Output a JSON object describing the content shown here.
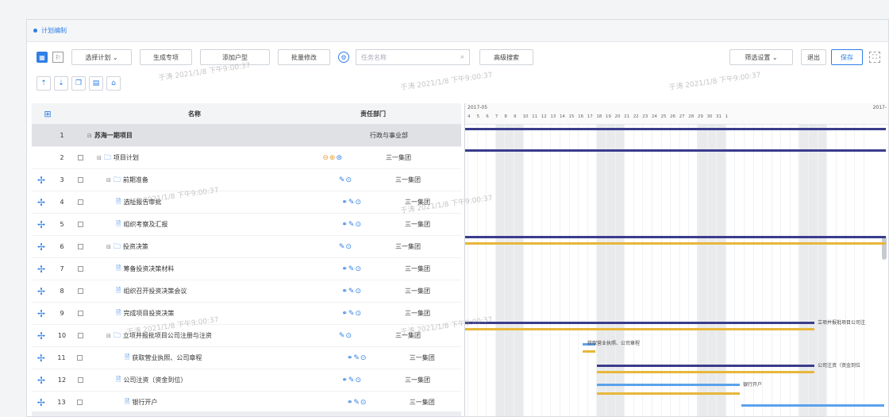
{
  "window": {
    "title": "计划编制"
  },
  "toolbar": {
    "buttons": [
      "选择计划 ⌄",
      "生成专项",
      "添加户型",
      "批量修改"
    ],
    "search_placeholder": "任务名称",
    "search_button": "高级搜索",
    "right_dropdown": "筛选设置 ⌄",
    "right_buttons": [
      "退出",
      "保存"
    ]
  },
  "grid": {
    "headers": {
      "name": "名称",
      "dept": "责任部门"
    },
    "rows": [
      {
        "num": "1",
        "name": "苏海一期项目",
        "dept": "行政与事业部",
        "level": 0
      },
      {
        "num": "2",
        "name": "项目计划",
        "dept": "三一集团",
        "level": 1
      },
      {
        "num": "3",
        "name": "前期准备",
        "dept": "三一集团",
        "level": 2
      },
      {
        "num": "4",
        "name": "选址报告审批",
        "dept": "三一集团",
        "level": 3
      },
      {
        "num": "5",
        "name": "组织考察及汇报",
        "dept": "三一集团",
        "level": 3
      },
      {
        "num": "6",
        "name": "投资决策",
        "dept": "三一集团",
        "level": 2
      },
      {
        "num": "7",
        "name": "筹备投资决策材料",
        "dept": "三一集团",
        "level": 3
      },
      {
        "num": "8",
        "name": "组织召开投资决策会议",
        "dept": "三一集团",
        "level": 3
      },
      {
        "num": "9",
        "name": "完成项目投资决策",
        "dept": "三一集团",
        "level": 3
      },
      {
        "num": "10",
        "name": "立项并报批项目公司注册与注资",
        "dept": "三一集团",
        "level": 2
      },
      {
        "num": "11",
        "name": "获取营业执照、公司章程",
        "dept": "三一集团",
        "level": 4
      },
      {
        "num": "12",
        "name": "公司注资（资金到位）",
        "dept": "三一集团",
        "level": 3
      },
      {
        "num": "13",
        "name": "银行开户",
        "dept": "三一集团",
        "level": 4
      }
    ]
  },
  "gantt": {
    "month_left": "2017-05",
    "month_right": "2017-",
    "days": [
      "4",
      "5",
      "6",
      "7",
      "8",
      "9",
      "10",
      "11",
      "12",
      "13",
      "14",
      "15",
      "16",
      "17",
      "18",
      "19",
      "20",
      "21",
      "22",
      "23",
      "24",
      "25",
      "26",
      "27",
      "28",
      "29",
      "30",
      "31",
      "1"
    ],
    "labels": [
      "立项并报批项目公司注",
      "获取营业执照、公司章程",
      "公司注资（资金到位",
      "银行开户"
    ]
  },
  "watermark": "于涛 2021/1/8 下午9:00:37"
}
